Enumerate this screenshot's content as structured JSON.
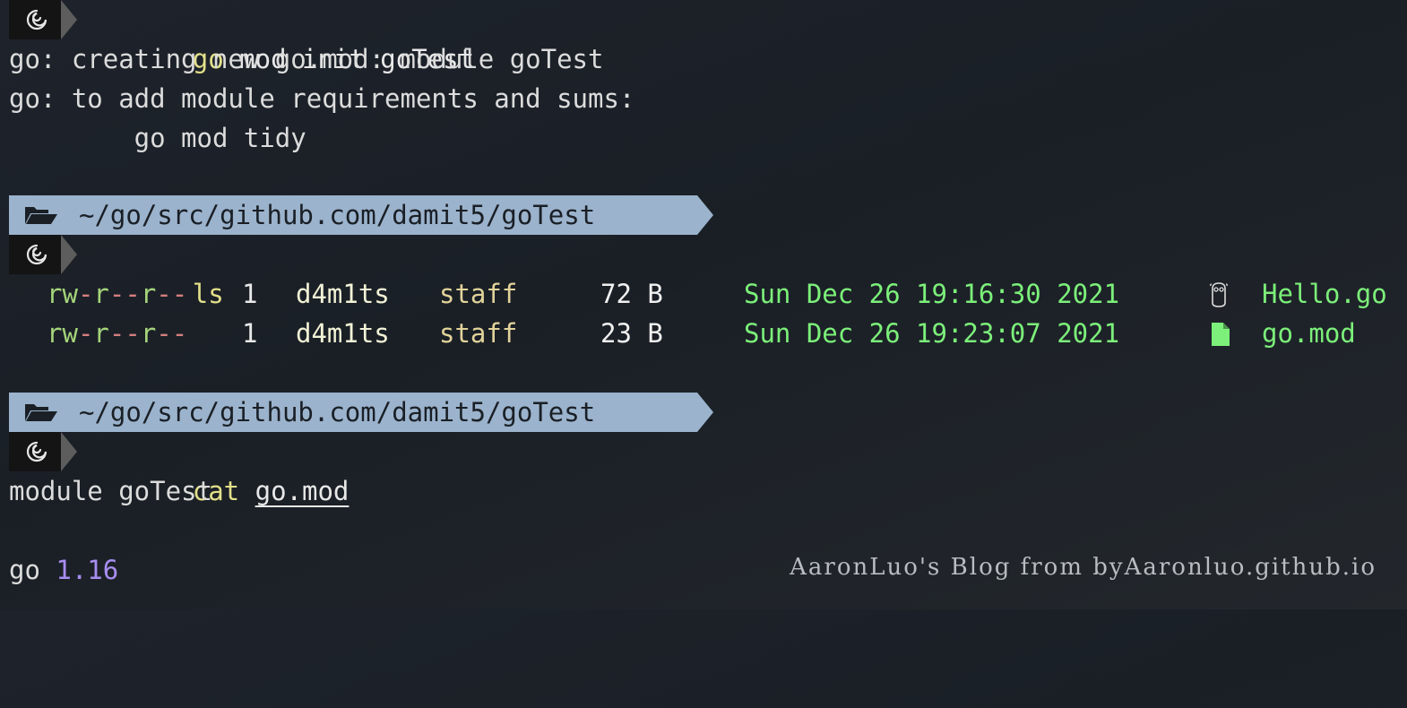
{
  "commands": [
    {
      "keyword": "go",
      "args": "mod init goTest"
    },
    {
      "keyword": "ls",
      "args": ""
    },
    {
      "keyword": "cat",
      "args": "go.mod"
    }
  ],
  "init_output": [
    "go: creating new go.mod: module goTest",
    "go: to add module requirements and sums:",
    "        go mod tidy"
  ],
  "cwd": "~/go/src/github.com/damit5/goTest",
  "ls_rows": [
    {
      "perm": "rw-r--r--",
      "links": "1",
      "owner": "d4m1ts",
      "group": "staff",
      "size": "72 B",
      "date": "Sun Dec 26 19:16:30 2021",
      "icon": "gopher-icon",
      "name": "Hello.go"
    },
    {
      "perm": "rw-r--r--",
      "links": "1",
      "owner": "d4m1ts",
      "group": "staff",
      "size": "23 B",
      "date": "Sun Dec 26 19:23:07 2021",
      "icon": "file-icon",
      "name": "go.mod"
    }
  ],
  "cat_output": {
    "module_line": "module goTest",
    "go_keyword": "go",
    "go_version": "1.16"
  },
  "watermark": "AaronLuo's Blog from byAaronluo.github.io",
  "colors": {
    "prompt_bg": "#141414",
    "dir_bar": "#9bb3cc",
    "command": "#e2e089",
    "date": "#7cf07a",
    "version": "#a88ef0"
  }
}
